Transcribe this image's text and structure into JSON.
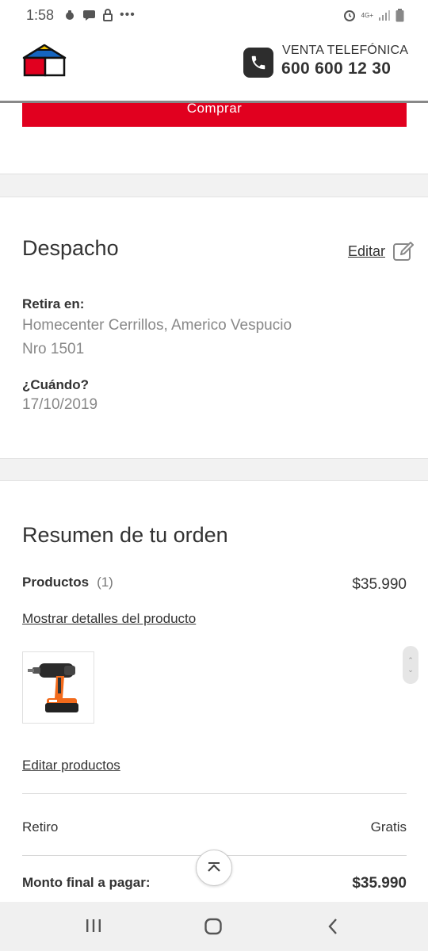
{
  "status_bar": {
    "time": "1:58",
    "network": "4G+"
  },
  "header": {
    "venta_label": "VENTA TELEFÓNICA",
    "phone_number": "600 600 12 30",
    "logo_icon": "house-logo-icon"
  },
  "buy": {
    "label": "Comprar",
    "color": "#e1001f"
  },
  "despacho": {
    "title": "Despacho",
    "edit_label": "Editar",
    "retira_label": "Retira en:",
    "store_line1": "Homecenter Cerrillos, Americo Vespucio",
    "store_line2": "Nro 1501",
    "when_label": "¿Cuándo?",
    "date": "17/10/2019"
  },
  "resumen": {
    "title": "Resumen de tu orden",
    "products_label": "Productos",
    "products_count": "(1)",
    "products_total": "$35.990",
    "show_details_link": "Mostrar detalles del producto",
    "edit_products_link": "Editar productos",
    "retiro_label": "Retiro",
    "retiro_value": "Gratis",
    "final_label": "Monto final a pagar:",
    "final_value": "$35.990"
  }
}
